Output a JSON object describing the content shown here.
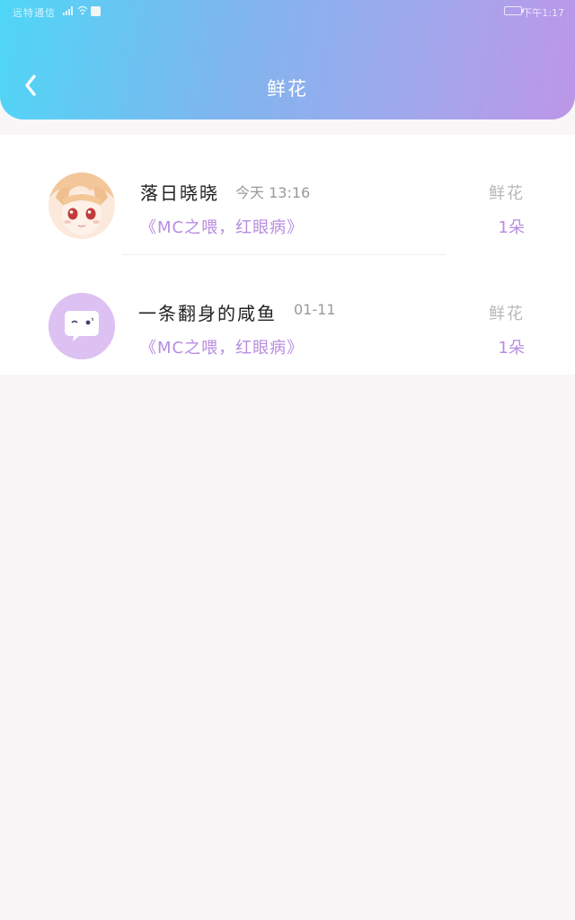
{
  "status_bar": {
    "carrier": "远特通信",
    "clock": "下午1:17"
  },
  "header": {
    "title": "鲜花"
  },
  "colors": {
    "gradient_start": "#4fd6f6",
    "gradient_end": "#bd96e8",
    "accent_purple": "#b88ce0"
  },
  "records": [
    {
      "name": "落日晓晓",
      "time": "今天  13:16",
      "work": "《MC之喂，红眼病》",
      "gift_label": "鲜花",
      "gift_count": "1朵",
      "avatar": "anime-girl-avatar"
    },
    {
      "name": "一条翻身的咸鱼",
      "time": "01-11",
      "work": "《MC之喂，红眼病》",
      "gift_label": "鲜花",
      "gift_count": "1朵",
      "avatar": "default-chat-avatar-icon"
    }
  ]
}
